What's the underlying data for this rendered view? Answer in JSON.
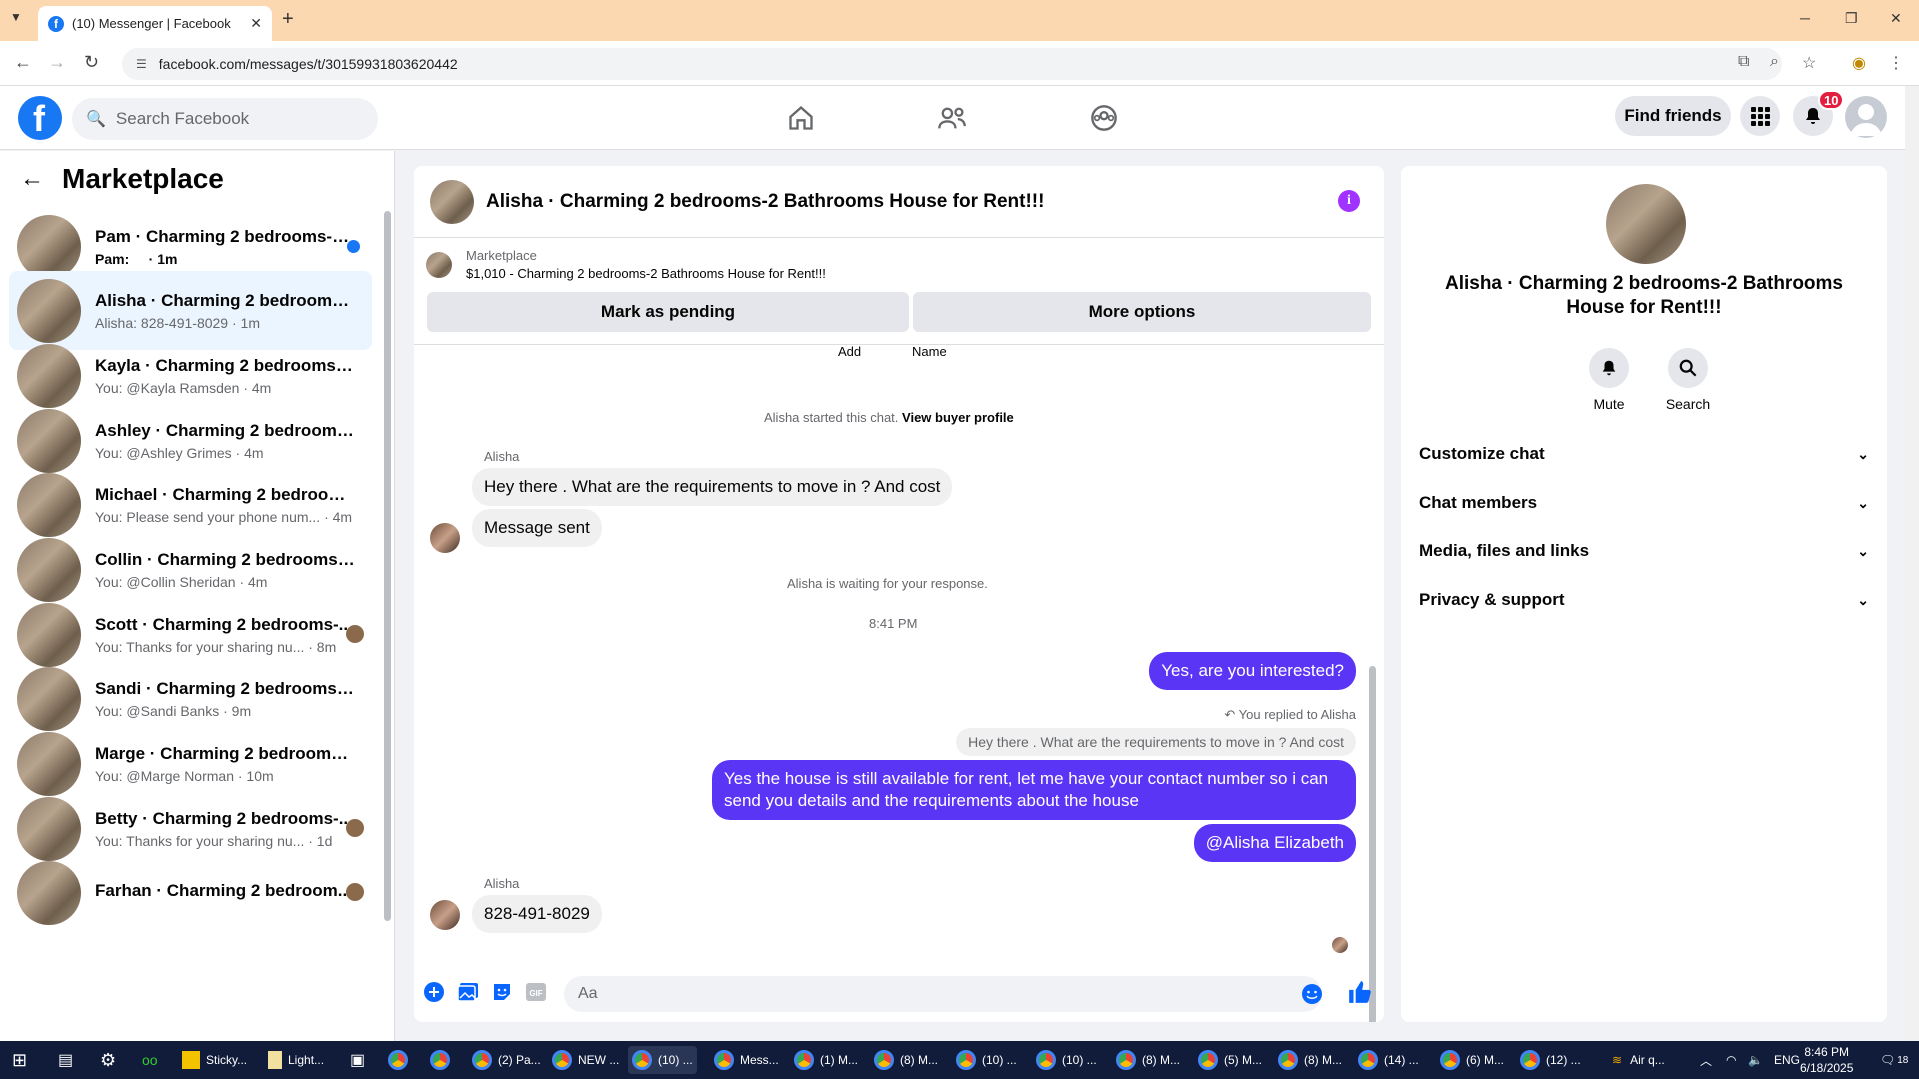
{
  "browser": {
    "tab_title": "(10) Messenger | Facebook",
    "url": "facebook.com/messages/t/30159931803620442"
  },
  "header": {
    "search_placeholder": "Search Facebook",
    "find_friends": "Find friends",
    "notif_count": "10"
  },
  "sidebar": {
    "title": "Marketplace",
    "conversations": [
      {
        "name": "Pam · Charming 2 bedrooms-2...",
        "sub": "Pam:     · 1m",
        "indicator": "unread"
      },
      {
        "name": "Alisha · Charming 2 bedrooms-2...",
        "sub": "Alisha: 828-491-8029 · 1m",
        "indicator": "none",
        "active": true
      },
      {
        "name": "Kayla · Charming 2 bedrooms-2 ...",
        "sub": "You: @Kayla Ramsden · 4m",
        "indicator": "none"
      },
      {
        "name": "Ashley · Charming 2 bedrooms-...",
        "sub": "You: @Ashley Grimes · 4m",
        "indicator": "none"
      },
      {
        "name": "Michael · Charming 2 bedrooms...",
        "sub": "You: Please send your phone num... · 4m",
        "indicator": "none"
      },
      {
        "name": "Collin · Charming 2 bedrooms-2 ...",
        "sub": "You: @Collin Sheridan · 4m",
        "indicator": "none"
      },
      {
        "name": "Scott · Charming 2 bedrooms-...",
        "sub": "You: Thanks for your sharing nu... · 8m",
        "indicator": "seen"
      },
      {
        "name": "Sandi · Charming 2 bedrooms-2 ...",
        "sub": "You: @Sandi Banks · 9m",
        "indicator": "none"
      },
      {
        "name": "Marge · Charming 2 bedrooms-...",
        "sub": "You: @Marge Norman · 10m",
        "indicator": "none"
      },
      {
        "name": "Betty · Charming 2 bedrooms-...",
        "sub": "You: Thanks for your sharing nu... · 1d",
        "indicator": "seen"
      },
      {
        "name": "Farhan · Charming 2 bedroom...",
        "sub": "",
        "indicator": "seen"
      }
    ]
  },
  "chat": {
    "title": "Alisha · Charming 2 bedrooms-2 Bathrooms House for Rent!!!",
    "marketplace_label": "Marketplace",
    "listing": "$1,010 - Charming 2 bedrooms-2 Bathrooms House for Rent!!!",
    "mark_pending": "Mark as pending",
    "more_options": "More options",
    "col_add": "Add",
    "col_name": "Name",
    "started_prefix": "Alisha started this chat.",
    "view_buyer": "View buyer profile",
    "sender1": "Alisha",
    "msg1": "Hey there . What are the requirements to move in ? And cost",
    "msg2": "Message sent",
    "waiting": "Alisha is waiting for your response.",
    "time": "8:41 PM",
    "msg3": "Yes, are you interested?",
    "replied": "You replied to Alisha",
    "quote": "Hey there . What are the requirements to move in ? And cost",
    "msg4": "Yes the house is still available for rent, let me have your contact number so i can send you details and the requirements about the house",
    "msg5": "@Alisha Elizabeth",
    "sender2": "Alisha",
    "msg6": "828-491-8029",
    "composer_placeholder": "Aa"
  },
  "rpanel": {
    "title": "Alisha · Charming 2 bedrooms-2 Bathrooms House for Rent!!!",
    "mute": "Mute",
    "search": "Search",
    "rows": [
      "Customize chat",
      "Chat members",
      "Media, files and links",
      "Privacy & support"
    ]
  },
  "taskbar": {
    "items": [
      "Sticky...",
      "Light...",
      "(2) Pa...",
      "NEW ...",
      "(10) ...",
      "Mess...",
      "(1) M...",
      "(8) M...",
      "(10) ...",
      "(10) ...",
      "(8) M...",
      "(5) M...",
      "(8) M...",
      "(14) ...",
      "(6) M...",
      "(12) ..."
    ],
    "air": "Air q...",
    "lang": "ENG",
    "clock_time": "8:46 PM",
    "clock_date": "6/18/2025",
    "notif_count": "18"
  }
}
